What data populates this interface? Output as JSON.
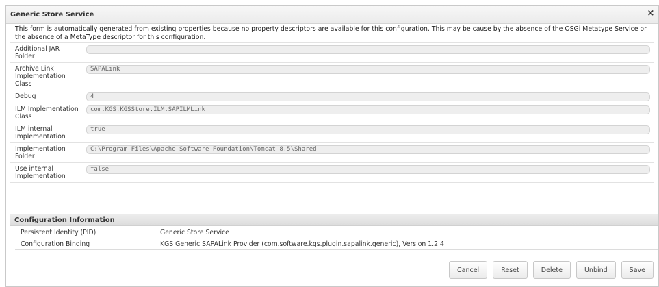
{
  "dialog": {
    "title": "Generic Store Service",
    "close_glyph": "×",
    "description": "This form is automatically generated from existing properties because no property descriptors are available for this configuration. This may be cause by the absence of the OSGi Metatype Service or the absence of a MetaType descriptor for this configuration."
  },
  "properties": [
    {
      "label": "Additional JAR Folder",
      "value": ""
    },
    {
      "label": "Archive Link Implementation Class",
      "value": "SAPALink"
    },
    {
      "label": "Debug",
      "value": "4"
    },
    {
      "label": "ILM Implementation Class",
      "value": "com.KGS.KGSStore.ILM.SAPILMLink"
    },
    {
      "label": "ILM internal Implementation",
      "value": "true"
    },
    {
      "label": "Implementation Folder",
      "value": "C:\\Program Files\\Apache Software Foundation\\Tomcat 8.5\\Shared"
    },
    {
      "label": "Use internal Implementation",
      "value": "false"
    }
  ],
  "config_info": {
    "heading": "Configuration Information",
    "rows": [
      {
        "key": "Persistent Identity (PID)",
        "value": "Generic Store Service"
      },
      {
        "key": "Configuration Binding",
        "value": "KGS Generic SAPALink Provider (com.software.kgs.plugin.sapalink.generic), Version 1.2.4"
      }
    ]
  },
  "buttons": {
    "cancel": "Cancel",
    "reset": "Reset",
    "delete": "Delete",
    "unbind": "Unbind",
    "save": "Save"
  }
}
